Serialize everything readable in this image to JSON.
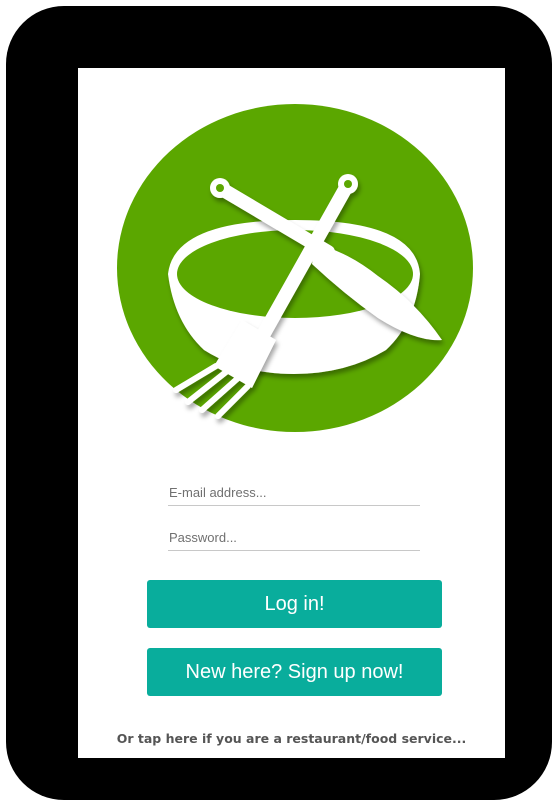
{
  "login": {
    "email_placeholder": "E-mail address...",
    "password_placeholder": "Password...",
    "login_button_label": "Log in!",
    "signup_button_label": "New here? Sign up now!",
    "restaurant_link_text": "Or tap here if you are a restaurant/food service..."
  },
  "logo": {
    "icon": "bowl-fork-knife-icon",
    "circle_color": "#5ba700",
    "glyph_color": "#ffffff"
  },
  "colors": {
    "accent": "#09ad9c",
    "device_frame": "#000000",
    "link_text": "#555555"
  }
}
